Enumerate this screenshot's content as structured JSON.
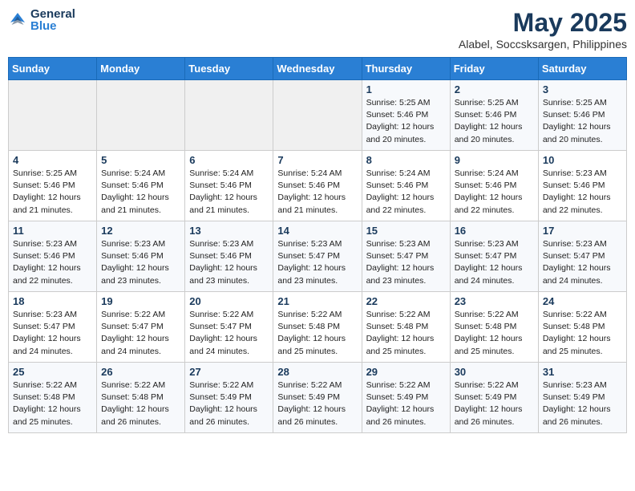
{
  "logo": {
    "general": "General",
    "blue": "Blue"
  },
  "calendar": {
    "title": "May 2025",
    "subtitle": "Alabel, Soccsksargen, Philippines"
  },
  "headers": [
    "Sunday",
    "Monday",
    "Tuesday",
    "Wednesday",
    "Thursday",
    "Friday",
    "Saturday"
  ],
  "weeks": [
    [
      {
        "num": "",
        "info": ""
      },
      {
        "num": "",
        "info": ""
      },
      {
        "num": "",
        "info": ""
      },
      {
        "num": "",
        "info": ""
      },
      {
        "num": "1",
        "info": "Sunrise: 5:25 AM\nSunset: 5:46 PM\nDaylight: 12 hours\nand 20 minutes."
      },
      {
        "num": "2",
        "info": "Sunrise: 5:25 AM\nSunset: 5:46 PM\nDaylight: 12 hours\nand 20 minutes."
      },
      {
        "num": "3",
        "info": "Sunrise: 5:25 AM\nSunset: 5:46 PM\nDaylight: 12 hours\nand 20 minutes."
      }
    ],
    [
      {
        "num": "4",
        "info": "Sunrise: 5:25 AM\nSunset: 5:46 PM\nDaylight: 12 hours\nand 21 minutes."
      },
      {
        "num": "5",
        "info": "Sunrise: 5:24 AM\nSunset: 5:46 PM\nDaylight: 12 hours\nand 21 minutes."
      },
      {
        "num": "6",
        "info": "Sunrise: 5:24 AM\nSunset: 5:46 PM\nDaylight: 12 hours\nand 21 minutes."
      },
      {
        "num": "7",
        "info": "Sunrise: 5:24 AM\nSunset: 5:46 PM\nDaylight: 12 hours\nand 21 minutes."
      },
      {
        "num": "8",
        "info": "Sunrise: 5:24 AM\nSunset: 5:46 PM\nDaylight: 12 hours\nand 22 minutes."
      },
      {
        "num": "9",
        "info": "Sunrise: 5:24 AM\nSunset: 5:46 PM\nDaylight: 12 hours\nand 22 minutes."
      },
      {
        "num": "10",
        "info": "Sunrise: 5:23 AM\nSunset: 5:46 PM\nDaylight: 12 hours\nand 22 minutes."
      }
    ],
    [
      {
        "num": "11",
        "info": "Sunrise: 5:23 AM\nSunset: 5:46 PM\nDaylight: 12 hours\nand 22 minutes."
      },
      {
        "num": "12",
        "info": "Sunrise: 5:23 AM\nSunset: 5:46 PM\nDaylight: 12 hours\nand 23 minutes."
      },
      {
        "num": "13",
        "info": "Sunrise: 5:23 AM\nSunset: 5:46 PM\nDaylight: 12 hours\nand 23 minutes."
      },
      {
        "num": "14",
        "info": "Sunrise: 5:23 AM\nSunset: 5:47 PM\nDaylight: 12 hours\nand 23 minutes."
      },
      {
        "num": "15",
        "info": "Sunrise: 5:23 AM\nSunset: 5:47 PM\nDaylight: 12 hours\nand 23 minutes."
      },
      {
        "num": "16",
        "info": "Sunrise: 5:23 AM\nSunset: 5:47 PM\nDaylight: 12 hours\nand 24 minutes."
      },
      {
        "num": "17",
        "info": "Sunrise: 5:23 AM\nSunset: 5:47 PM\nDaylight: 12 hours\nand 24 minutes."
      }
    ],
    [
      {
        "num": "18",
        "info": "Sunrise: 5:23 AM\nSunset: 5:47 PM\nDaylight: 12 hours\nand 24 minutes."
      },
      {
        "num": "19",
        "info": "Sunrise: 5:22 AM\nSunset: 5:47 PM\nDaylight: 12 hours\nand 24 minutes."
      },
      {
        "num": "20",
        "info": "Sunrise: 5:22 AM\nSunset: 5:47 PM\nDaylight: 12 hours\nand 24 minutes."
      },
      {
        "num": "21",
        "info": "Sunrise: 5:22 AM\nSunset: 5:48 PM\nDaylight: 12 hours\nand 25 minutes."
      },
      {
        "num": "22",
        "info": "Sunrise: 5:22 AM\nSunset: 5:48 PM\nDaylight: 12 hours\nand 25 minutes."
      },
      {
        "num": "23",
        "info": "Sunrise: 5:22 AM\nSunset: 5:48 PM\nDaylight: 12 hours\nand 25 minutes."
      },
      {
        "num": "24",
        "info": "Sunrise: 5:22 AM\nSunset: 5:48 PM\nDaylight: 12 hours\nand 25 minutes."
      }
    ],
    [
      {
        "num": "25",
        "info": "Sunrise: 5:22 AM\nSunset: 5:48 PM\nDaylight: 12 hours\nand 25 minutes."
      },
      {
        "num": "26",
        "info": "Sunrise: 5:22 AM\nSunset: 5:48 PM\nDaylight: 12 hours\nand 26 minutes."
      },
      {
        "num": "27",
        "info": "Sunrise: 5:22 AM\nSunset: 5:49 PM\nDaylight: 12 hours\nand 26 minutes."
      },
      {
        "num": "28",
        "info": "Sunrise: 5:22 AM\nSunset: 5:49 PM\nDaylight: 12 hours\nand 26 minutes."
      },
      {
        "num": "29",
        "info": "Sunrise: 5:22 AM\nSunset: 5:49 PM\nDaylight: 12 hours\nand 26 minutes."
      },
      {
        "num": "30",
        "info": "Sunrise: 5:22 AM\nSunset: 5:49 PM\nDaylight: 12 hours\nand 26 minutes."
      },
      {
        "num": "31",
        "info": "Sunrise: 5:23 AM\nSunset: 5:49 PM\nDaylight: 12 hours\nand 26 minutes."
      }
    ]
  ]
}
